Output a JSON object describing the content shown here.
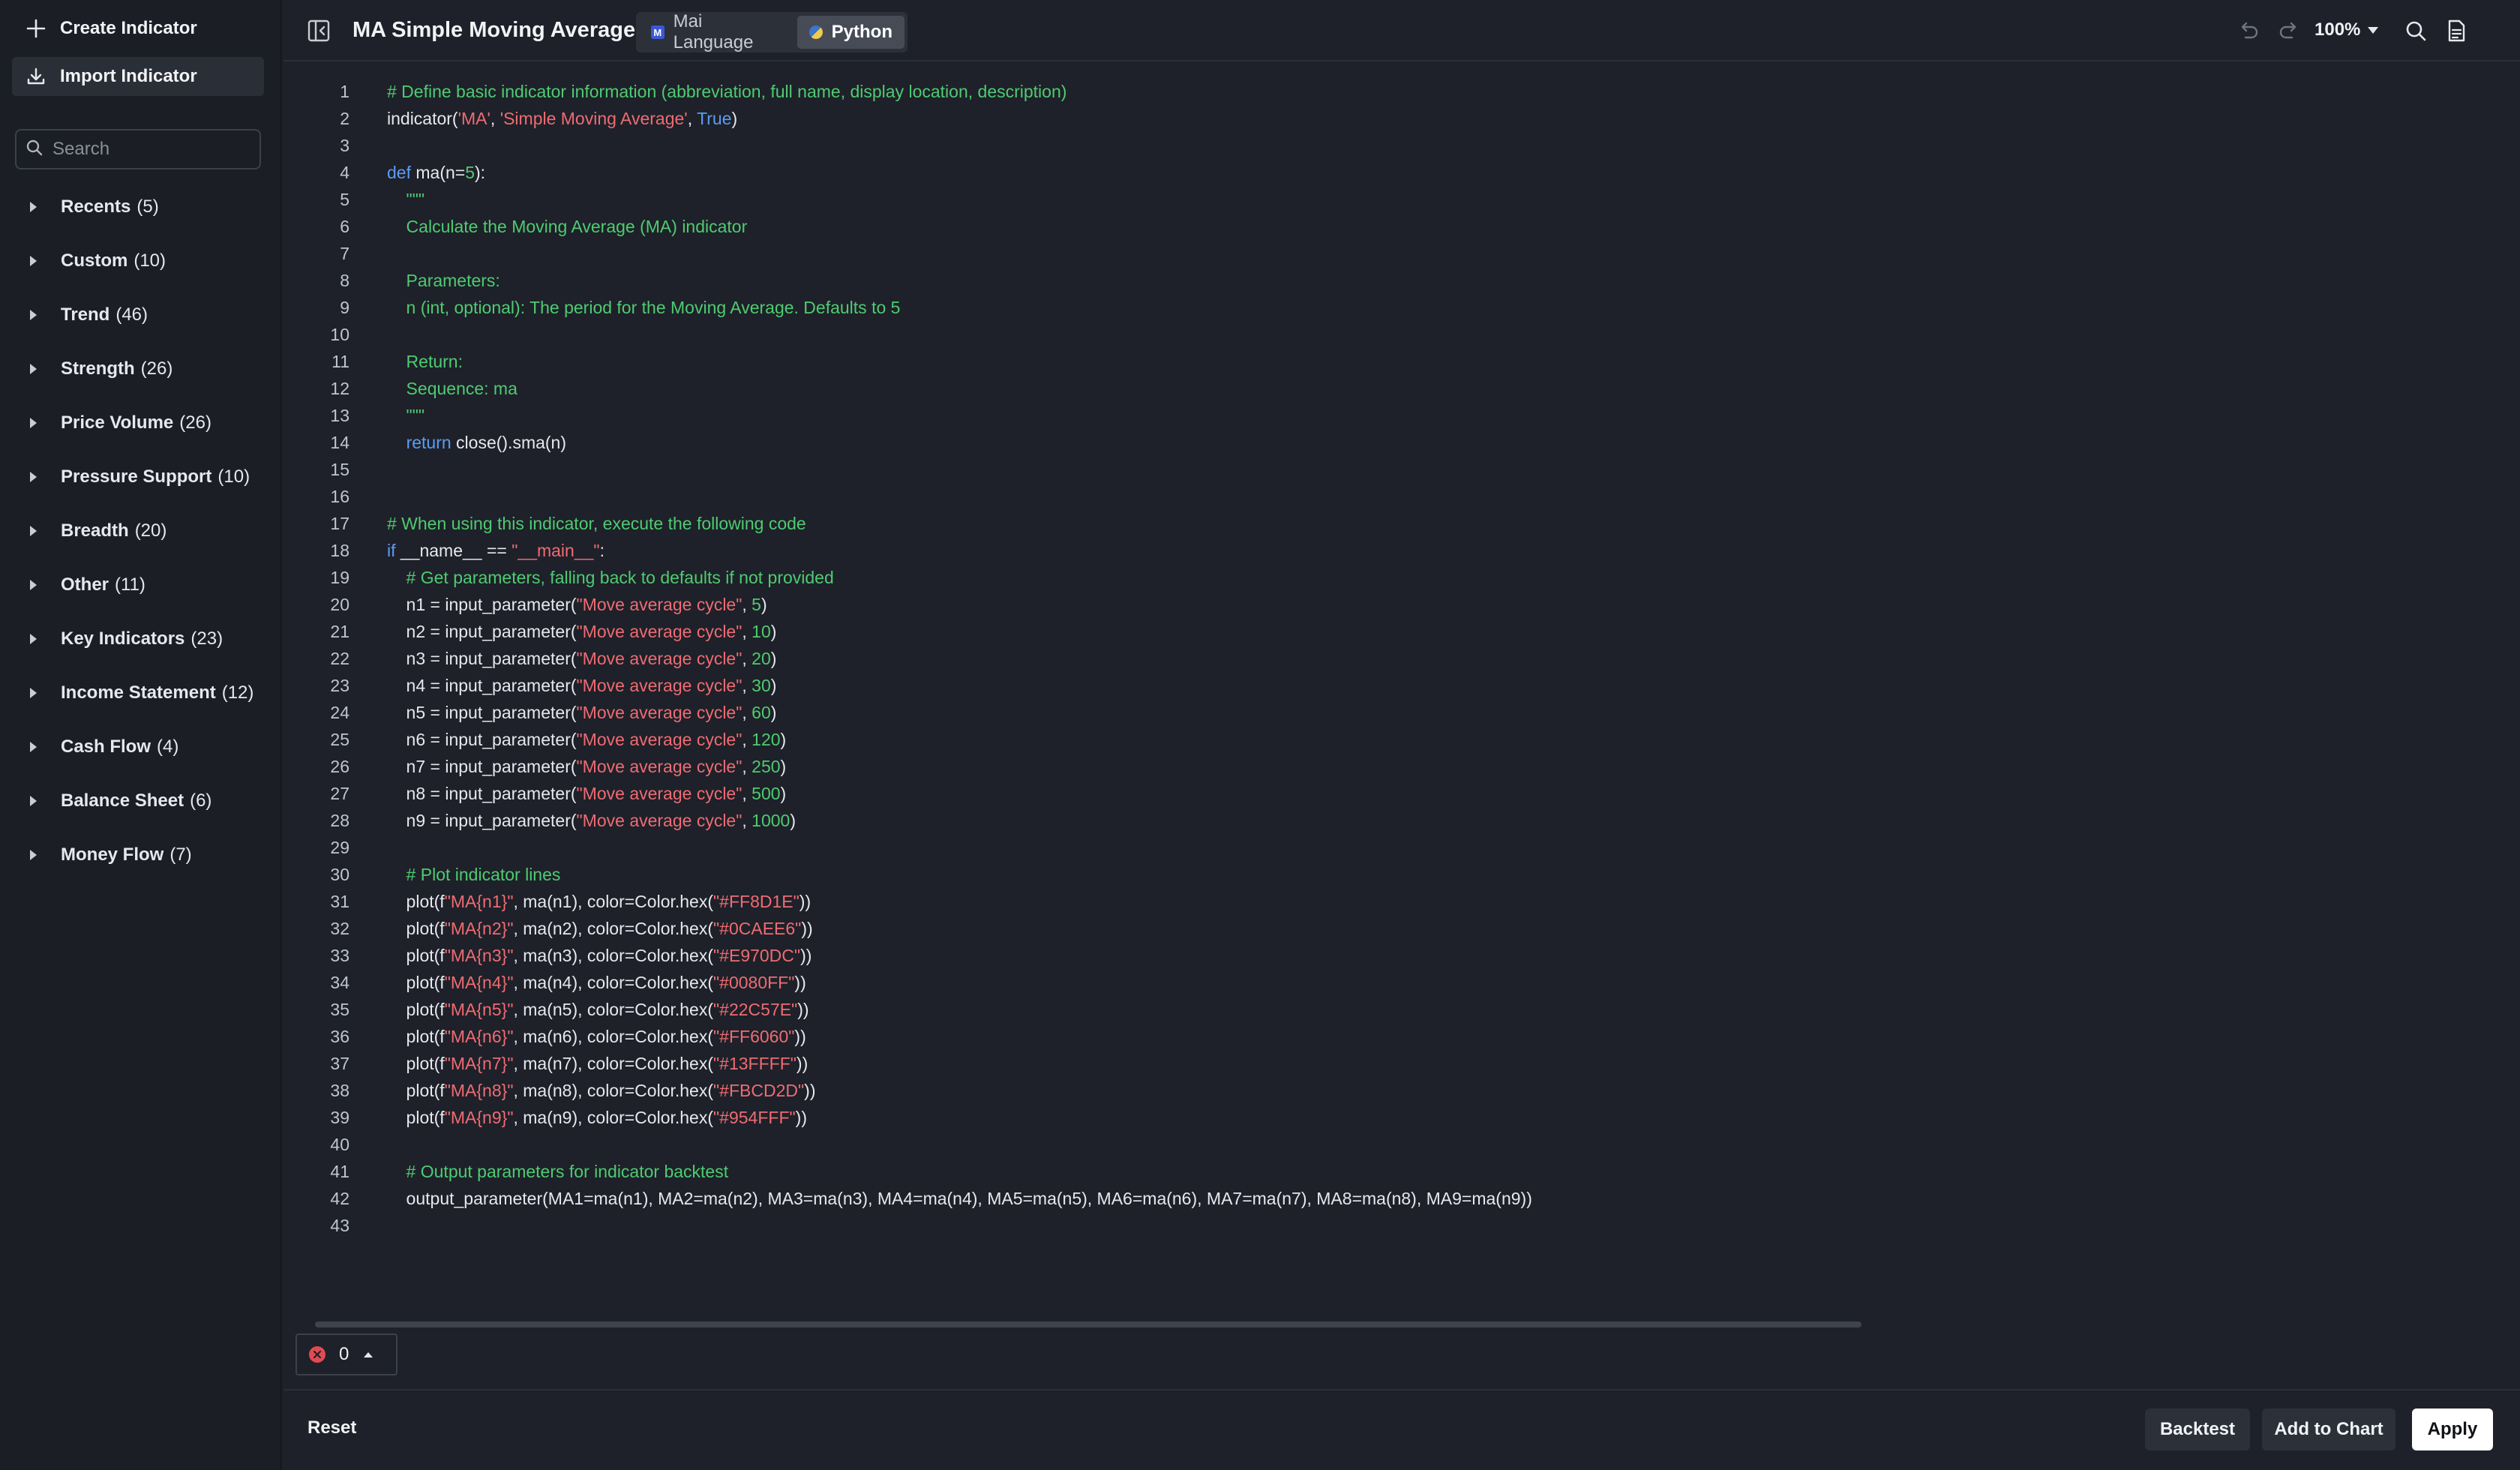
{
  "sidebar": {
    "create_label": "Create Indicator",
    "import_label": "Import Indicator",
    "search_placeholder": "Search",
    "categories": [
      {
        "name": "Recents",
        "count": "(5)"
      },
      {
        "name": "Custom",
        "count": "(10)"
      },
      {
        "name": "Trend",
        "count": "(46)"
      },
      {
        "name": "Strength",
        "count": "(26)"
      },
      {
        "name": "Price Volume",
        "count": "(26)"
      },
      {
        "name": "Pressure Support",
        "count": "(10)"
      },
      {
        "name": "Breadth",
        "count": "(20)"
      },
      {
        "name": "Other",
        "count": "(11)"
      },
      {
        "name": "Key Indicators",
        "count": "(23)"
      },
      {
        "name": "Income Statement",
        "count": "(12)"
      },
      {
        "name": "Cash Flow",
        "count": "(4)"
      },
      {
        "name": "Balance Sheet",
        "count": "(6)"
      },
      {
        "name": "Money Flow",
        "count": "(7)"
      }
    ]
  },
  "header": {
    "title": "MA Simple Moving Average",
    "tabs": [
      {
        "label": "Mai Language",
        "badge": "M",
        "active": false
      },
      {
        "label": "Python",
        "badge": "",
        "active": true
      }
    ],
    "zoom": "100%"
  },
  "editor": {
    "lines": [
      "# Define basic indicator information (abbreviation, full name, display location, description)",
      "indicator('MA', 'Simple Moving Average', True)",
      "",
      "def ma(n=5):",
      "    \"\"\"",
      "    Calculate the Moving Average (MA) indicator",
      "",
      "    Parameters:",
      "    n (int, optional): The period for the Moving Average. Defaults to 5",
      "",
      "    Return:",
      "    Sequence: ma",
      "    \"\"\"",
      "    return close().sma(n)",
      "",
      "",
      "# When using this indicator, execute the following code",
      "if __name__ == \"__main__\":",
      "    # Get parameters, falling back to defaults if not provided",
      "    n1 = input_parameter(\"Move average cycle\", 5)",
      "    n2 = input_parameter(\"Move average cycle\", 10)",
      "    n3 = input_parameter(\"Move average cycle\", 20)",
      "    n4 = input_parameter(\"Move average cycle\", 30)",
      "    n5 = input_parameter(\"Move average cycle\", 60)",
      "    n6 = input_parameter(\"Move average cycle\", 120)",
      "    n7 = input_parameter(\"Move average cycle\", 250)",
      "    n8 = input_parameter(\"Move average cycle\", 500)",
      "    n9 = input_parameter(\"Move average cycle\", 1000)",
      "",
      "    # Plot indicator lines",
      "    plot(f\"MA{n1}\", ma(n1), color=Color.hex(\"#FF8D1E\"))",
      "    plot(f\"MA{n2}\", ma(n2), color=Color.hex(\"#0CAEE6\"))",
      "    plot(f\"MA{n3}\", ma(n3), color=Color.hex(\"#E970DC\"))",
      "    plot(f\"MA{n4}\", ma(n4), color=Color.hex(\"#0080FF\"))",
      "    plot(f\"MA{n5}\", ma(n5), color=Color.hex(\"#22C57E\"))",
      "    plot(f\"MA{n6}\", ma(n6), color=Color.hex(\"#FF6060\"))",
      "    plot(f\"MA{n7}\", ma(n7), color=Color.hex(\"#13FFFF\"))",
      "    plot(f\"MA{n8}\", ma(n8), color=Color.hex(\"#FBCD2D\"))",
      "    plot(f\"MA{n9}\", ma(n9), color=Color.hex(\"#954FFF\"))",
      "",
      "    # Output parameters for indicator backtest",
      "    output_parameter(MA1=ma(n1), MA2=ma(n2), MA3=ma(n3), MA4=ma(n4), MA5=ma(n5), MA6=ma(n6), MA7=ma(n7), MA8=ma(n8), MA9=ma(n9))",
      ""
    ],
    "error_count": "0"
  },
  "footer": {
    "reset_label": "Reset",
    "backtest_label": "Backtest",
    "add_to_chart_label": "Add to Chart",
    "apply_label": "Apply"
  },
  "colors": {
    "background": "#1e2129",
    "sidebar": "#1b1e25",
    "comment": "#4ecb71",
    "string": "#ef6b73",
    "keyword": "#5b9cf5",
    "error": "#e24a52"
  },
  "icons": [
    "plus-icon",
    "download-icon",
    "search-icon",
    "caret-right-icon",
    "sidebar-toggle-icon",
    "undo-icon",
    "redo-icon",
    "search-icon",
    "document-icon",
    "error-icon",
    "chevron-up-icon"
  ]
}
